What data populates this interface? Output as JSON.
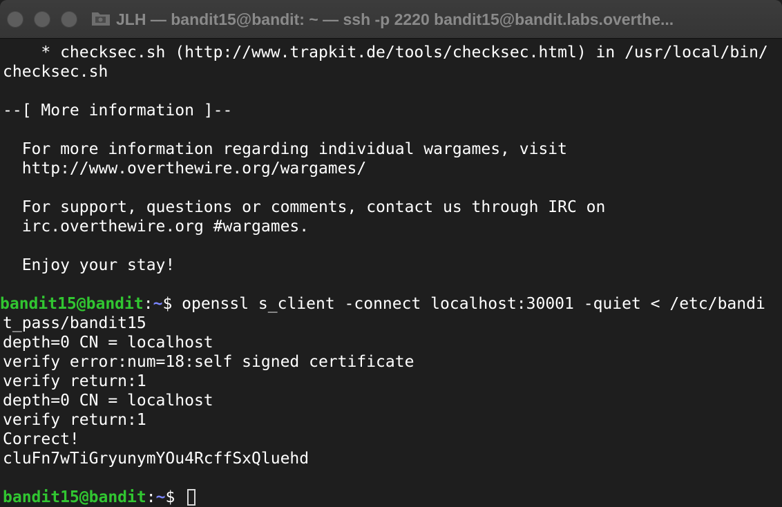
{
  "window": {
    "title": "JLH — bandit15@bandit: ~ — ssh -p 2220 bandit15@bandit.labs.overthe..."
  },
  "terminal": {
    "lines": [
      "    * checksec.sh (http://www.trapkit.de/tools/checksec.html) in /usr/local/bin/",
      "checksec.sh",
      "",
      "--[ More information ]--",
      "",
      "  For more information regarding individual wargames, visit",
      "  http://www.overthewire.org/wargames/",
      "",
      "  For support, questions or comments, contact us through IRC on",
      "  irc.overthewire.org #wargames.",
      "",
      "  Enjoy your stay!",
      ""
    ],
    "prompt1": {
      "user_host": "bandit15@bandit",
      "sep": ":",
      "path": "~",
      "dollar": "$ ",
      "command": "openssl s_client -connect localhost:30001 -quiet < /etc/bandi"
    },
    "output": [
      "t_pass/bandit15",
      "depth=0 CN = localhost",
      "verify error:num=18:self signed certificate",
      "verify return:1",
      "depth=0 CN = localhost",
      "verify return:1",
      "Correct!",
      "cluFn7wTiGryunymYOu4RcffSxQluehd",
      ""
    ],
    "prompt2": {
      "user_host": "bandit15@bandit",
      "sep": ":",
      "path": "~",
      "dollar": "$ "
    }
  },
  "colors": {
    "background": "#1e1e1e",
    "prompt_user": "#31c631",
    "prompt_path": "#7a86ff",
    "text": "#ffffff"
  }
}
